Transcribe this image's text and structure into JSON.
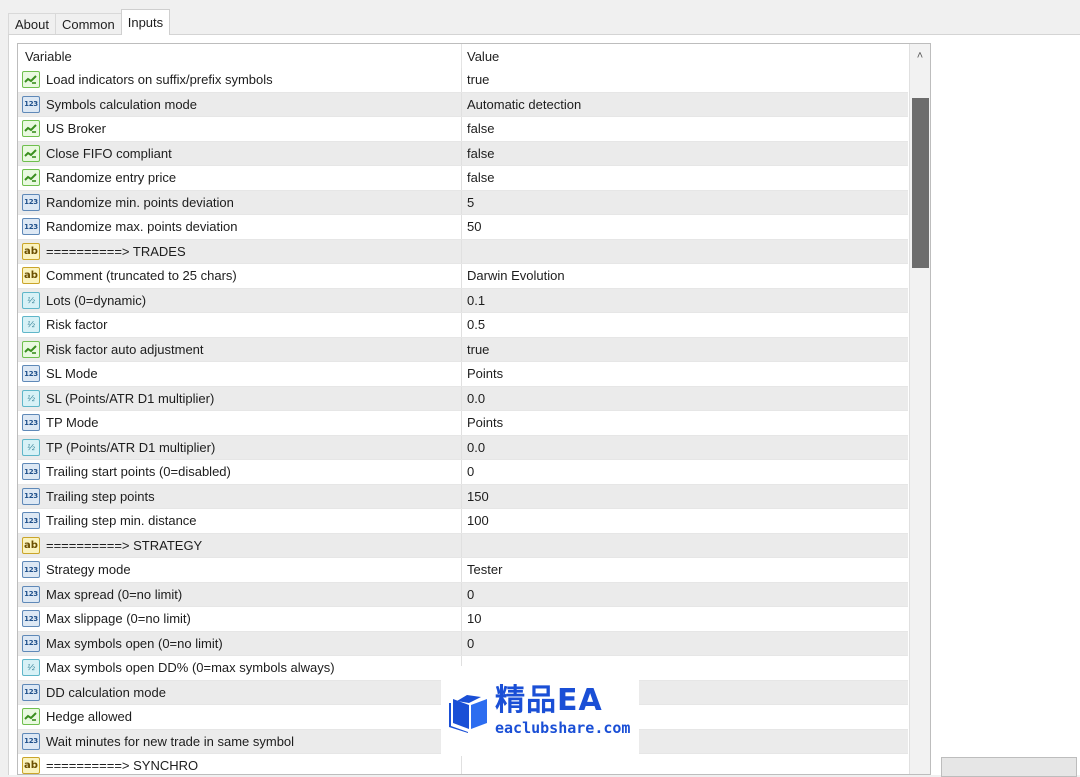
{
  "tabs": [
    {
      "label": "About"
    },
    {
      "label": "Common"
    },
    {
      "label": "Inputs"
    }
  ],
  "active_tab": "Inputs",
  "grid": {
    "headers": {
      "variable": "Variable",
      "value": "Value"
    },
    "rows": [
      {
        "type": "bool",
        "name": "Load indicators on suffix/prefix symbols",
        "value": "true"
      },
      {
        "type": "int",
        "name": "Symbols calculation mode",
        "value": "Automatic detection"
      },
      {
        "type": "bool",
        "name": "US Broker",
        "value": "false"
      },
      {
        "type": "bool",
        "name": "Close FIFO compliant",
        "value": "false"
      },
      {
        "type": "bool",
        "name": "Randomize entry price",
        "value": "false"
      },
      {
        "type": "int",
        "name": "Randomize min. points deviation",
        "value": "5"
      },
      {
        "type": "int",
        "name": "Randomize max. points deviation",
        "value": "50"
      },
      {
        "type": "string",
        "name": "==========> TRADES",
        "value": ""
      },
      {
        "type": "string",
        "name": "Comment (truncated to 25 chars)",
        "value": "Darwin Evolution"
      },
      {
        "type": "double",
        "name": "Lots (0=dynamic)",
        "value": "0.1"
      },
      {
        "type": "double",
        "name": "Risk factor",
        "value": "0.5"
      },
      {
        "type": "bool",
        "name": "Risk factor auto adjustment",
        "value": "true"
      },
      {
        "type": "int",
        "name": "SL Mode",
        "value": "Points"
      },
      {
        "type": "double",
        "name": "SL (Points/ATR D1 multiplier)",
        "value": "0.0"
      },
      {
        "type": "int",
        "name": "TP Mode",
        "value": "Points"
      },
      {
        "type": "double",
        "name": "TP (Points/ATR D1 multiplier)",
        "value": "0.0"
      },
      {
        "type": "int",
        "name": "Trailing start points (0=disabled)",
        "value": "0"
      },
      {
        "type": "int",
        "name": "Trailing step points",
        "value": "150"
      },
      {
        "type": "int",
        "name": "Trailing step min. distance",
        "value": "100"
      },
      {
        "type": "string",
        "name": "==========> STRATEGY",
        "value": ""
      },
      {
        "type": "int",
        "name": "Strategy mode",
        "value": "Tester"
      },
      {
        "type": "int",
        "name": "Max spread (0=no limit)",
        "value": "0"
      },
      {
        "type": "int",
        "name": "Max slippage (0=no limit)",
        "value": "10"
      },
      {
        "type": "int",
        "name": "Max symbols open (0=no limit)",
        "value": "0"
      },
      {
        "type": "double",
        "name": "Max symbols open DD% (0=max symbols always)",
        "value": ""
      },
      {
        "type": "int",
        "name": "DD calculation mode",
        "value": ""
      },
      {
        "type": "bool",
        "name": "Hedge allowed",
        "value": ""
      },
      {
        "type": "int",
        "name": "Wait minutes for new trade in same symbol",
        "value": ""
      },
      {
        "type": "string",
        "name": "==========> SYNCHRO",
        "value": ""
      }
    ]
  },
  "icons": {
    "bool": "bool-type-icon",
    "int": "int-type-icon",
    "string": "string-type-icon",
    "double": "double-type-icon"
  },
  "icon_glyphs": {
    "int": "123",
    "string": "ab",
    "double": "½"
  },
  "scrollbar": {
    "up_glyph": "˄"
  },
  "watermark": {
    "title": "精品EA",
    "subtitle": "eaclubshare.com"
  },
  "colors": {
    "row_alt": "#ebebeb",
    "watermark_blue": "#1a4fd6",
    "scroll_thumb": "#6d6d6d"
  }
}
